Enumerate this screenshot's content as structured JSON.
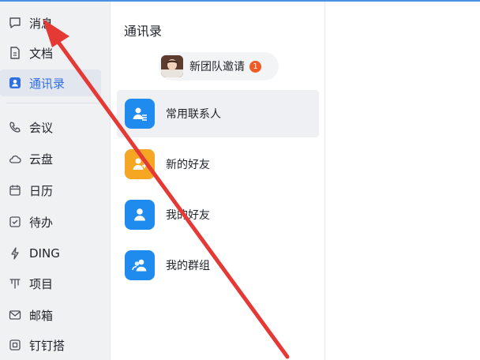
{
  "sidebar": {
    "items": [
      {
        "label": "消息",
        "icon": "chat-bubble-icon"
      },
      {
        "label": "文档",
        "icon": "document-icon"
      },
      {
        "label": "通讯录",
        "icon": "contacts-icon",
        "active": true
      },
      {
        "label": "会议",
        "icon": "phone-icon"
      },
      {
        "label": "云盘",
        "icon": "cloud-icon"
      },
      {
        "label": "日历",
        "icon": "calendar-icon"
      },
      {
        "label": "待办",
        "icon": "checkbox-icon"
      },
      {
        "label": "DING",
        "icon": "lightning-icon"
      },
      {
        "label": "项目",
        "icon": "project-icon"
      },
      {
        "label": "邮箱",
        "icon": "mail-icon"
      },
      {
        "label": "钉钉搭",
        "icon": "builder-icon"
      }
    ]
  },
  "contacts": {
    "title": "通讯录",
    "invite": {
      "label": "新团队邀请",
      "badge": "1"
    },
    "items": [
      {
        "label": "常用联系人",
        "icon": "frequent-contacts-icon",
        "color": "#1f8bef",
        "active": true
      },
      {
        "label": "新的好友",
        "icon": "new-friend-icon",
        "color": "#f5a623"
      },
      {
        "label": "我的好友",
        "icon": "my-friends-icon",
        "color": "#1f8bef"
      },
      {
        "label": "我的群组",
        "icon": "my-groups-icon",
        "color": "#1f8bef"
      }
    ]
  },
  "colors": {
    "accent": "#2f6fe4",
    "badge": "#f05a24",
    "annotation_arrow": "#e53935"
  }
}
